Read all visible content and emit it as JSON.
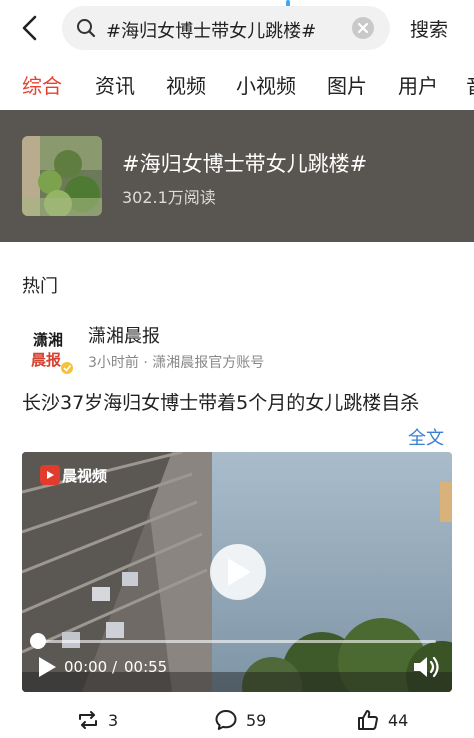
{
  "search": {
    "query": "#海归女博士带女儿跳楼#",
    "submit_label": "搜索"
  },
  "tabs": [
    {
      "label": "综合",
      "active": true
    },
    {
      "label": "资讯",
      "active": false
    },
    {
      "label": "视频",
      "active": false
    },
    {
      "label": "小视频",
      "active": false
    },
    {
      "label": "图片",
      "active": false
    },
    {
      "label": "用户",
      "active": false
    },
    {
      "label": "音",
      "active": false
    }
  ],
  "topic": {
    "title": "#海归女博士带女儿跳楼#",
    "reads": "302.1万阅读"
  },
  "hot_section": {
    "title": "热门"
  },
  "post": {
    "author": {
      "logo_text": "潇湘晨报",
      "name": "潇湘晨报",
      "meta": "3小时前 · 潇湘晨报官方账号"
    },
    "headline": "长沙37岁海归女博士带着5个月的女儿跳楼自杀",
    "full_text_label": "全文",
    "video": {
      "brand": "晨视频",
      "time_current": "00:00",
      "time_separator": "/",
      "time_total": "00:55",
      "progress": 0
    },
    "actions": {
      "repost_count": "3",
      "comment_count": "59",
      "like_count": "44"
    }
  },
  "colors": {
    "accent": "#e8402f",
    "link": "#3c7fd1",
    "banner": "#595550"
  }
}
